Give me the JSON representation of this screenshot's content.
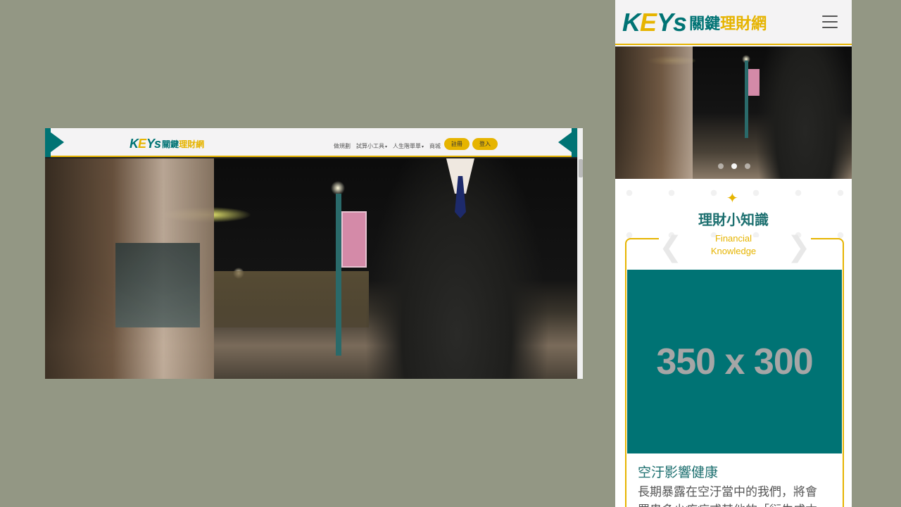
{
  "brand": {
    "logo_k": "K",
    "logo_e": "E",
    "logo_ys": "Ys",
    "logo_zh_dark": "關鍵",
    "logo_zh_gold": "理財網",
    "primary_color": "#007374",
    "accent_color": "#e6b400"
  },
  "desktop": {
    "nav": [
      {
        "label": "做規劃",
        "has_caret": false
      },
      {
        "label": "試算小工具",
        "has_caret": true
      },
      {
        "label": "人生階單單",
        "has_caret": true
      },
      {
        "label": "商城",
        "has_caret": false
      }
    ],
    "register_label": "註冊",
    "login_label": "登入",
    "caret": "▾"
  },
  "mobile": {
    "menu_icon": "hamburger-icon",
    "carousel_dots": 3,
    "carousel_active_index": 1,
    "section_star": "✦",
    "section_title": "理財小知識",
    "section_subtitle_line1": "Financial",
    "section_subtitle_line2": "Knowledge",
    "placeholder_text": "350 x 300",
    "article_title": "空汙影響健康",
    "article_text": "長期暴露在空汙當中的我們，將會罹患多少疾病或其他的「衍生成本」"
  }
}
